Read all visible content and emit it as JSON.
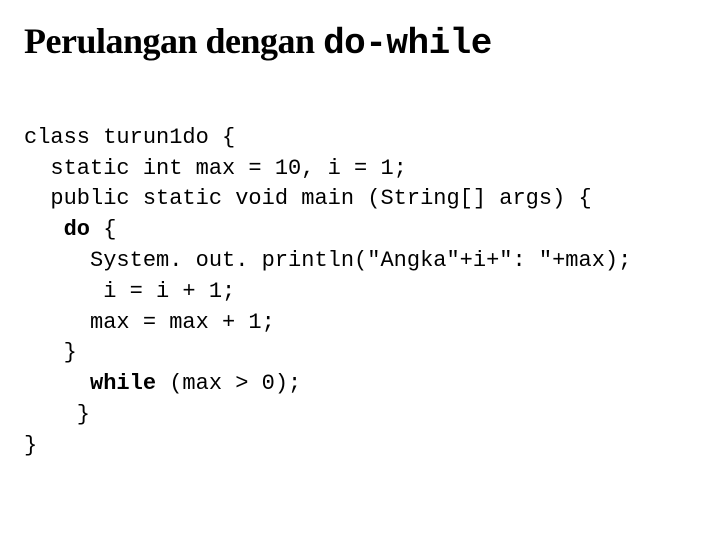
{
  "title": {
    "prefix": "Perulangan dengan ",
    "mono": "do-while"
  },
  "code": {
    "l1": "class turun1do {",
    "l2": "  static int max = 10, i = 1;",
    "l3": "  public static void main (String[] args) {",
    "l4a": "   ",
    "l4b": "do",
    "l4c": " {",
    "l5": "     System. out. println(\"Angka\"+i+\": \"+max);",
    "l6": "      i = i + 1;",
    "l7": "     max = max + 1;",
    "l8": "   }",
    "l9a": "     ",
    "l9b": "while",
    "l9c": " (max > 0);",
    "l10": "    }",
    "l11": "}"
  }
}
